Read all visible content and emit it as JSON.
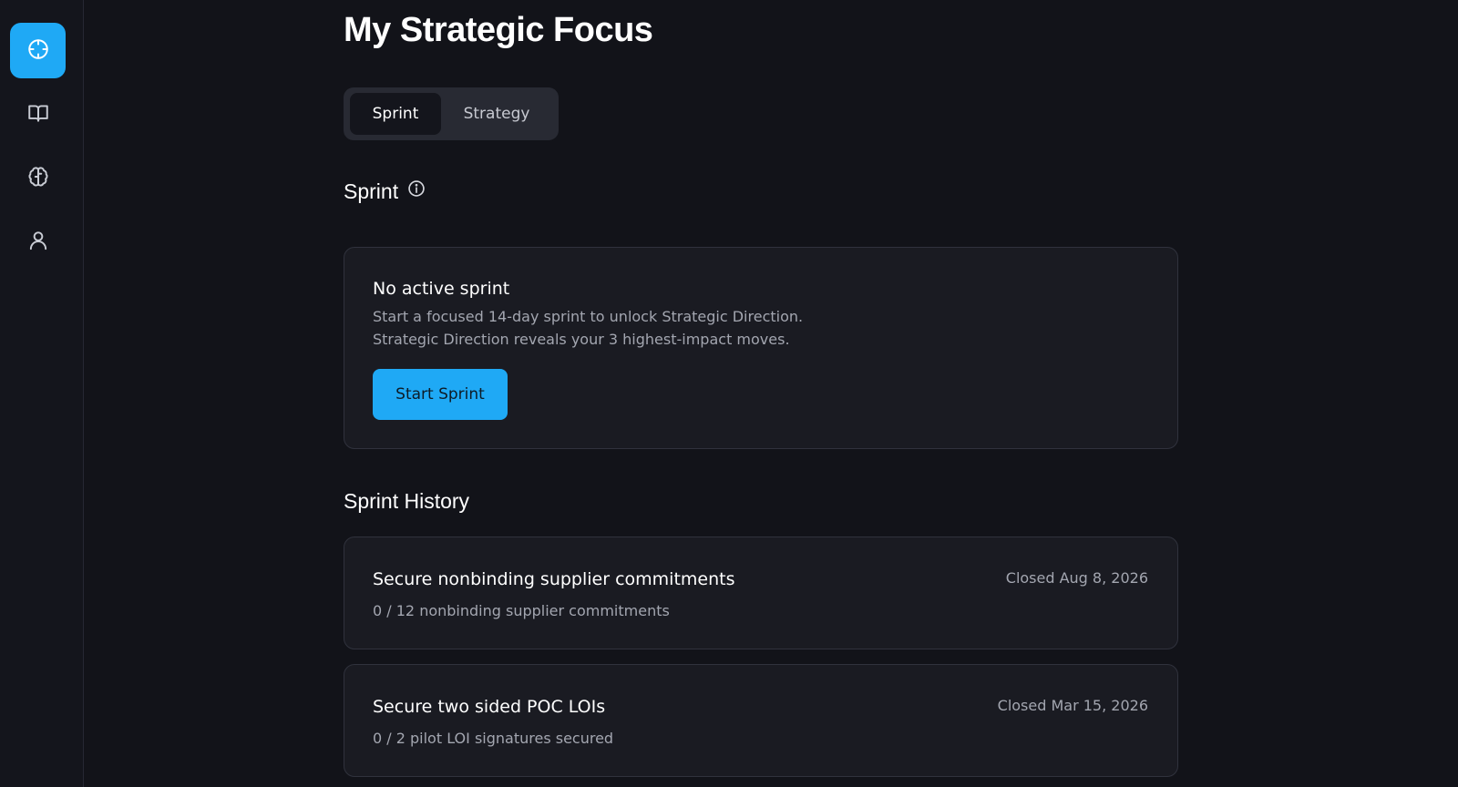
{
  "sidebar": {
    "items": [
      {
        "icon": "crosshair-icon",
        "active": true
      },
      {
        "icon": "book-icon",
        "active": false
      },
      {
        "icon": "brain-icon",
        "active": false
      },
      {
        "icon": "user-icon",
        "active": false
      }
    ],
    "accent": "#1fa9f5"
  },
  "page": {
    "title": "My Strategic Focus"
  },
  "tabs": {
    "items": [
      "Sprint",
      "Strategy"
    ],
    "selected": "Sprint"
  },
  "sprint_section": {
    "heading": "Sprint",
    "info_icon": "info-icon",
    "card": {
      "title": "No active sprint",
      "line1": "Start a focused 14-day sprint to unlock Strategic Direction.",
      "line2": "Strategic Direction reveals your 3 highest-impact moves.",
      "button_label": "Start Sprint"
    }
  },
  "history": {
    "heading": "Sprint History",
    "items": [
      {
        "title": "Secure nonbinding supplier commitments",
        "progress": "0 / 12 nonbinding supplier commitments",
        "status": "Closed Aug 8, 2026"
      },
      {
        "title": "Secure two sided POC LOIs",
        "progress": "0 / 2 pilot LOI signatures secured",
        "status": "Closed Mar 15, 2026"
      }
    ]
  }
}
